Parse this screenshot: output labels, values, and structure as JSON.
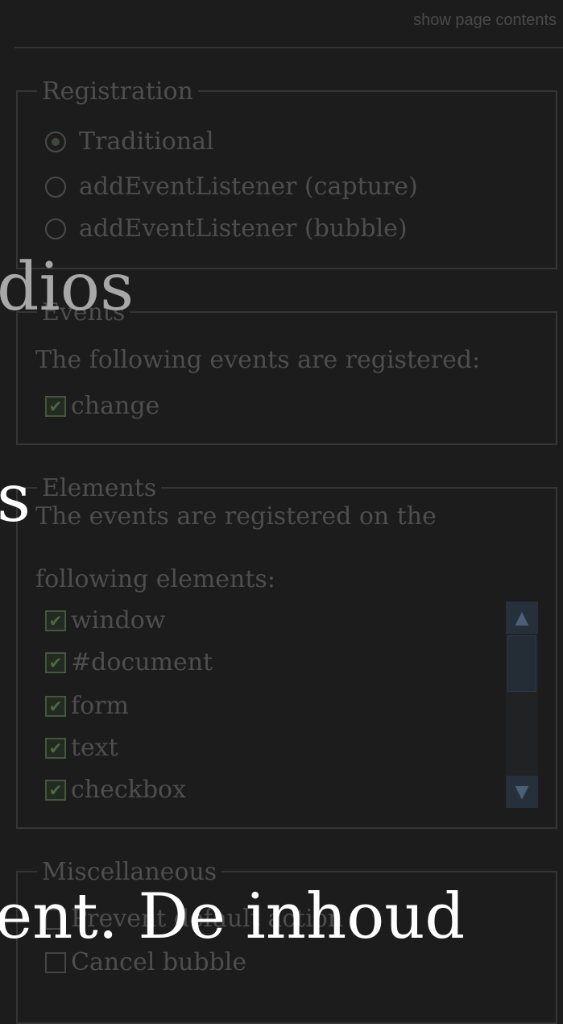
{
  "top_link": "show page contents",
  "registration": {
    "legend": "Registration",
    "options": [
      {
        "label": "Traditional",
        "selected": true
      },
      {
        "label": "addEventListener (capture)",
        "selected": false
      },
      {
        "label": "addEventListener (bubble)",
        "selected": false
      }
    ]
  },
  "events": {
    "legend": "Events",
    "description": "The following events are registered:",
    "items": [
      {
        "label": "change",
        "checked": true
      }
    ]
  },
  "elements": {
    "legend": "Elements",
    "description_line1": "The events are registered on the",
    "description_line2": "following elements:",
    "items": [
      {
        "label": "window",
        "checked": true
      },
      {
        "label": "#document",
        "checked": true
      },
      {
        "label": "form",
        "checked": true
      },
      {
        "label": "text",
        "checked": true
      },
      {
        "label": "checkbox",
        "checked": true
      }
    ]
  },
  "misc": {
    "legend": "Miscellaneous",
    "items": [
      {
        "label": "Prevent default action",
        "checked": false
      },
      {
        "label": "Cancel bubble",
        "checked": false
      }
    ]
  },
  "overlay": {
    "line1": "dios",
    "line2": "s",
    "line3": "ent. De inhoud"
  }
}
